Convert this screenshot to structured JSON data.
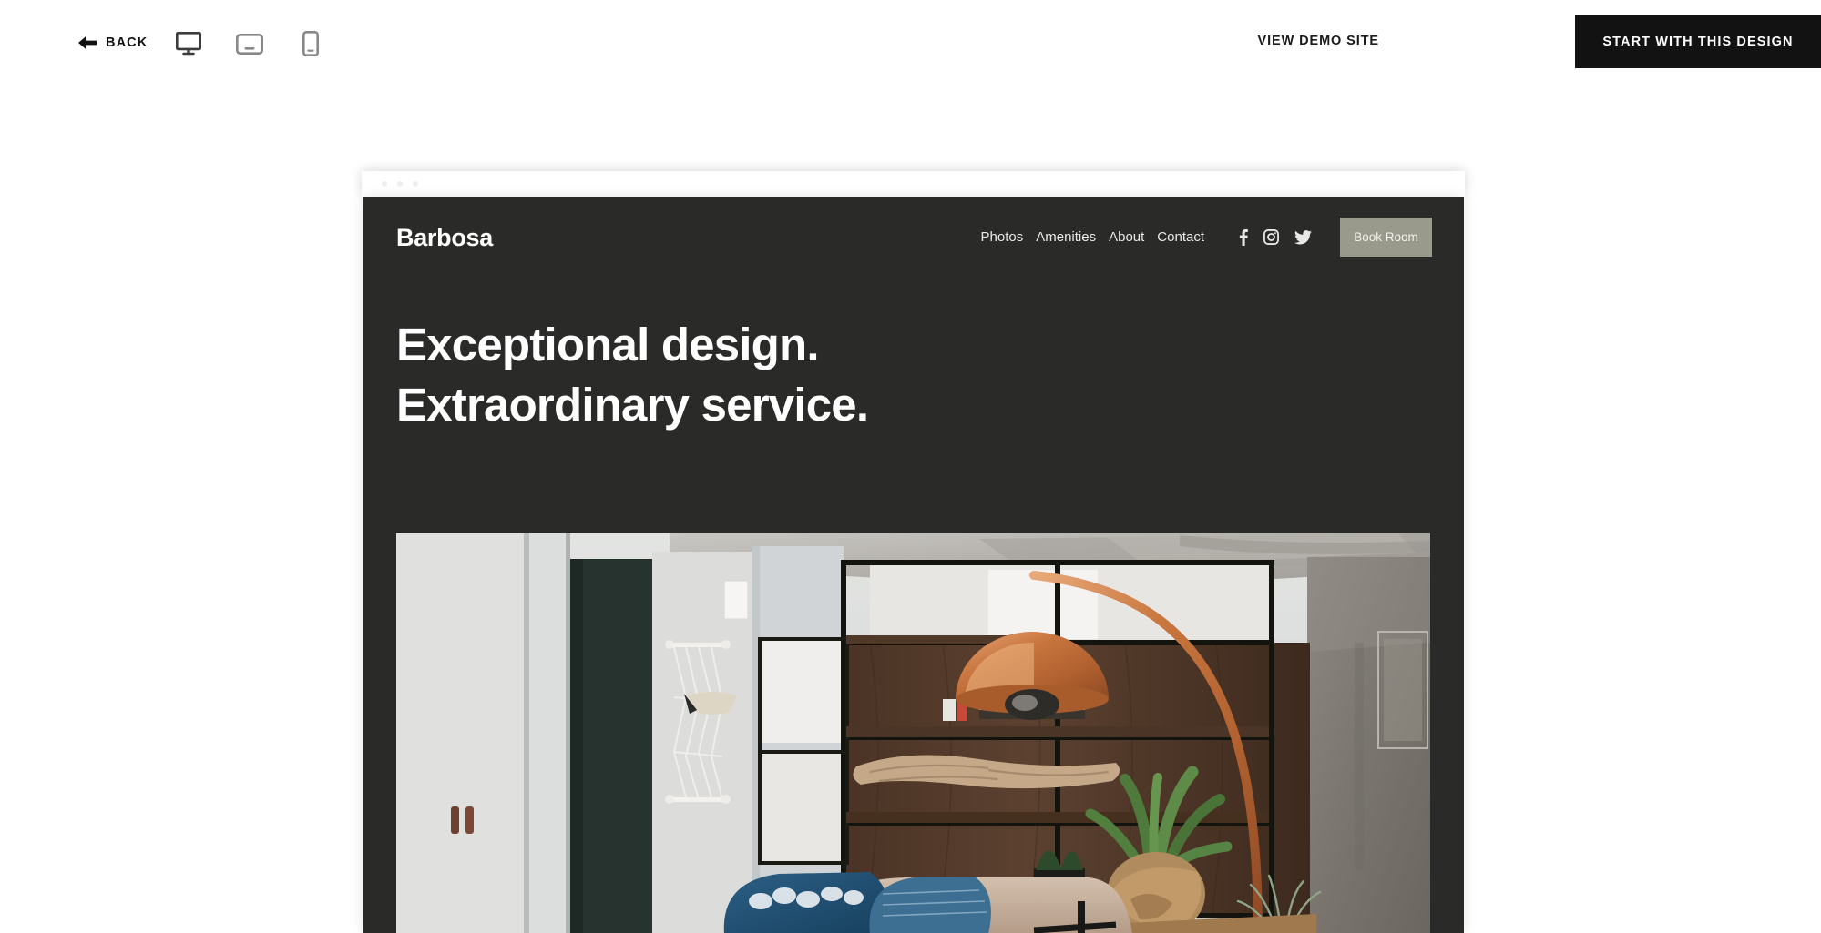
{
  "toolbar": {
    "back_label": "BACK",
    "back_icon": "arrow-left-icon",
    "devices": [
      {
        "name": "desktop",
        "icon": "desktop-monitor-icon",
        "active": true
      },
      {
        "name": "tablet",
        "icon": "tablet-icon",
        "active": false
      },
      {
        "name": "mobile",
        "icon": "mobile-phone-icon",
        "active": false
      }
    ],
    "view_demo_label": "VIEW DEMO SITE",
    "start_design_label": "START WITH THIS DESIGN"
  },
  "preview": {
    "browser_dots": 3,
    "site": {
      "logo": "Barbosa",
      "nav_links": [
        "Photos",
        "Amenities",
        "About",
        "Contact"
      ],
      "social": [
        {
          "name": "facebook",
          "icon": "facebook-icon"
        },
        {
          "name": "instagram",
          "icon": "instagram-icon"
        },
        {
          "name": "twitter",
          "icon": "twitter-icon"
        }
      ],
      "book_button_label": "Book Room",
      "headline_line1": "Exceptional design.",
      "headline_line2": "Extraordinary service.",
      "hero_photo_alt": "Modern loft interior with copper arc lamp, walnut shelving and indoor plants"
    }
  },
  "colors": {
    "page_background": "#ffffff",
    "toolbar_text": "#111111",
    "cta_background": "#121212",
    "cta_text": "#ffffff",
    "site_background": "#2a2a28",
    "site_text": "#ffffff",
    "book_button_background": "#9a9a8c",
    "device_active": "#3c3c3c",
    "device_inactive": "#888888"
  }
}
